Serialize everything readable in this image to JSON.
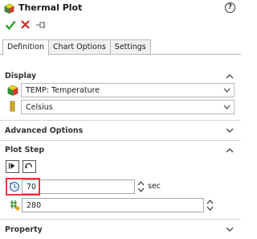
{
  "header": {
    "title": "Thermal Plot",
    "help_glyph": "?"
  },
  "tabs": [
    {
      "label": "Definition",
      "active": true
    },
    {
      "label": "Chart Options",
      "active": false
    },
    {
      "label": "Settings",
      "active": false
    }
  ],
  "display": {
    "title": "Display",
    "quantity": "TEMP: Temperature",
    "units": "Celsius"
  },
  "advanced": {
    "title": "Advanced Options"
  },
  "plot_step": {
    "title": "Plot Step",
    "time_value": "70",
    "time_unit": "sec",
    "step_value": "280"
  },
  "property": {
    "title": "Property"
  },
  "colors": {
    "ok_green": "#2e9e2e",
    "cancel_red": "#d62828",
    "highlight_red": "#e33a3a"
  }
}
